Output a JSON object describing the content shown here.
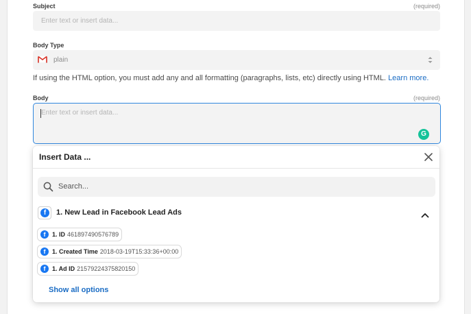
{
  "subject": {
    "label": "Subject",
    "required": "(required)",
    "placeholder": "Enter text or insert data..."
  },
  "body_type": {
    "label": "Body Type",
    "value": "plain",
    "help_text": "If using the HTML option, you must add any and all formatting (paragraphs, lists, etc) directly using HTML.",
    "help_link": "Learn more."
  },
  "body": {
    "label": "Body",
    "required": "(required)",
    "placeholder": "Enter text or insert data..."
  },
  "insert_data": {
    "title": "Insert Data ...",
    "search_placeholder": "Search...",
    "app_step": "1. New Lead in Facebook Lead Ads",
    "items": [
      {
        "key": "1. ID",
        "value": "461897490576789"
      },
      {
        "key": "1. Created Time",
        "value": "2018-03-19T15:33:36+00:00"
      },
      {
        "key": "1. Ad ID",
        "value": "21579224375820150"
      }
    ],
    "show_all": "Show all options"
  },
  "colors": {
    "accent_blue": "#2e86de",
    "link": "#1a6cc4",
    "facebook": "#1877f2",
    "grammarly": "#15c39a"
  }
}
